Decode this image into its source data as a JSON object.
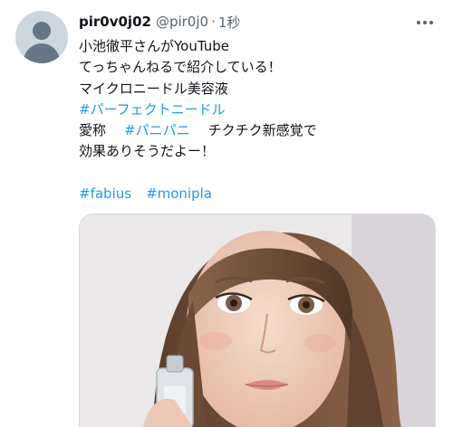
{
  "tweet": {
    "author_name": "pir0v0j02",
    "handle": "@pir0j0",
    "separator": "·",
    "time": "1秒",
    "lines": {
      "l1": "小池徹平さんがYouTube",
      "l2": "てっちゃんねるで紹介している！",
      "l3": "マイクロニードル美容液",
      "l4_tag": "#パーフェクトニードル",
      "l5_text": "愛称",
      "l5_tag": "#パニパニ",
      "l5_rest": "チクチク新感覚で",
      "l6": "効果ありそうだよー！",
      "l8_tag1": "#fabius",
      "l8_tag2": "#monipla"
    }
  },
  "icons": {
    "avatar": "default-profile-icon",
    "more": "more-horizontal-icon"
  },
  "colors": {
    "link": "#1d9bf0",
    "secondary_text": "#536471",
    "primary_text": "#0f1419"
  }
}
